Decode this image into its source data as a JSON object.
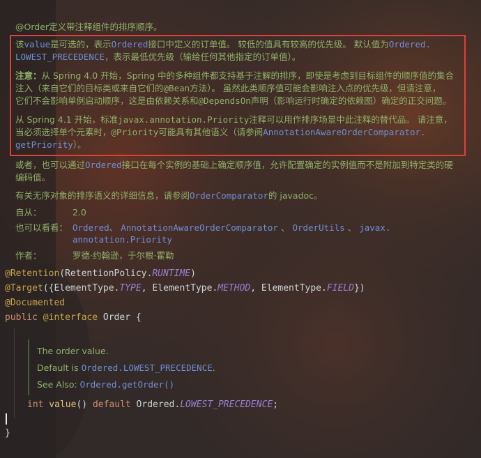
{
  "doc": {
    "title": "@Order定义带注释组件的排序顺序。",
    "para1": {
      "t1": "该",
      "value": "value",
      "t2": "是可选的，表示",
      "ordered": "Ordered",
      "t3": "接口中定义的订单值。 较低的值具有较高的优先级。 默认值为",
      "ordered2": "Ordered.",
      "line2a": "LOWEST_PRECEDENCE",
      "line2b": "，表示最低优先级（输给任何其他指定的订单值）。"
    },
    "para2": {
      "label": "注意：",
      "l1": "从 Spring 4.0 开始，Spring 中的多种组件都支持基于注解的排序，即使是考虑到目标组件的顺序值的集合",
      "l2a": "注入（来自它们的目标类或来自它们的",
      "bean": "@Bean",
      "l2b": "方法）。 虽然此类顺序值可能会影响注入点的优先级，但请注意，",
      "l3a": "它们不会影响单例启动顺序，这是由依赖关系和",
      "dependson": "@DependsOn",
      "l3b": "声明（影响运行时确定的依赖图）确定的正交问题。"
    },
    "para3": {
      "l1a": "从 Spring 4.1 开始，标准",
      "priority": "javax.annotation.Priority",
      "l1b": "注释可以用作排序场景中此注释的替代品。 请注意，",
      "l2a": "当必须选择单个元素时，",
      "priority2": "@Priority",
      "l2b": "可能具有其他语义（请参阅",
      "link": "AnnotationAwareOrderComparator.",
      "l3link": "getPriority",
      "l3b": "）。"
    },
    "para4": {
      "l1a": "或者，也可以通过",
      "ordered": "Ordered",
      "l1b": "接口在每个实例的基础上确定顺序值，允许配置确定的实例值而不是附加到特定类的硬",
      "l2": "编码值。"
    },
    "para5": {
      "t1": "有关无序对象的排序语义的详细信息，请参阅",
      "link": "OrderComparator",
      "t2": "的 javadoc。"
    },
    "since": {
      "label": "自从：",
      "value": "2.0"
    },
    "see_also": {
      "label": "也可以看看：",
      "item1": "Ordered",
      "sep": "、",
      "item2": "AnnotationAwareOrderComparator",
      "item3": "OrderUtils",
      "item4a": "javax.",
      "item4b": "annotation.Priority"
    },
    "author": {
      "label": "作者：",
      "value": "罗德·约翰逊，于尔根·霍勒"
    }
  },
  "code": {
    "l1": {
      "anno": "@Retention",
      "p1": "(RetentionPolicy.",
      "c": "RUNTIME",
      "p2": ")"
    },
    "l2": {
      "anno": "@Target",
      "p1": "({ElementType.",
      "c1": "TYPE",
      "p2": ", ElementType.",
      "c2": "METHOD",
      "p3": ", ElementType.",
      "c3": "FIELD",
      "p4": "})"
    },
    "l3": {
      "anno": "@Documented"
    },
    "l4": {
      "kw": "public",
      "anno": " @interface",
      "name": " Order {"
    },
    "inner": {
      "desc": "The order value.",
      "default_label": "Default is ",
      "default_link": "Ordered.LOWEST_PRECEDENCE",
      "default_end": ".",
      "see_label": "See Also: ",
      "see_link": "Ordered.getOrder()"
    },
    "l5": {
      "kw": "int",
      "method": " value",
      "p1": "() ",
      "kw2": "default",
      "p2": " Ordered.",
      "c": "LOWEST_PRECEDENCE",
      "p3": ";"
    },
    "close": "}"
  },
  "colors": {
    "comment": "#8fb06a",
    "link": "#6f8fd6",
    "annotation": "#c7a44a",
    "keyword": "#cf8e6d",
    "constant": "#9a7fd0",
    "highlight_box": "#e0403a"
  }
}
